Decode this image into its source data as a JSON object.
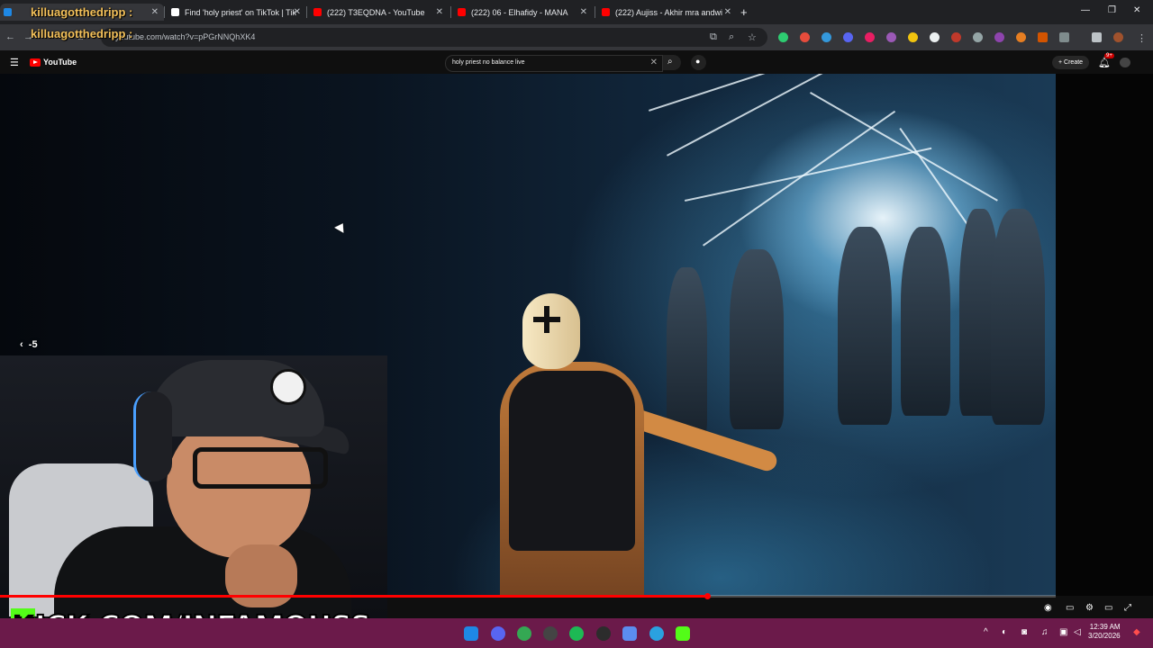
{
  "browser": {
    "tabs": [
      {
        "label": "",
        "icon": "streamer-icon"
      },
      {
        "label": "Find 'holy priest' on TikTok | Tik",
        "icon": "tiktok-icon"
      },
      {
        "label": "(222) T3EQDNA - YouTube",
        "icon": "youtube-icon"
      },
      {
        "label": "(222) 06 - Elhafidy - MANA",
        "icon": "youtube-icon"
      },
      {
        "label": "(222) Aujiss - Akhir mra andwi",
        "icon": "youtube-icon"
      }
    ],
    "url": "youtube.com/watch?v=pPGrNNQhXK4"
  },
  "overlay": {
    "streamer_name": "killuagotthedripp :",
    "streamer_name_2": "killuagotthedripp :",
    "kick_banner": "KICK.COM/INFAMOUSS",
    "kick_letter": "K"
  },
  "youtube": {
    "logo": "YouTube",
    "search_value": "holy priest no balance live",
    "create_label": "Create",
    "notifications": "9+"
  },
  "player": {
    "skip_label": "-5",
    "progress": 0.667
  },
  "taskbar": {
    "time": "12:39 AM",
    "date": "3/20/2026"
  },
  "colors": {
    "yt_red": "#ff0000",
    "kick_green": "#53fc18",
    "taskbar": "#6b1a4a",
    "overlay_name": "#f4c15a"
  }
}
